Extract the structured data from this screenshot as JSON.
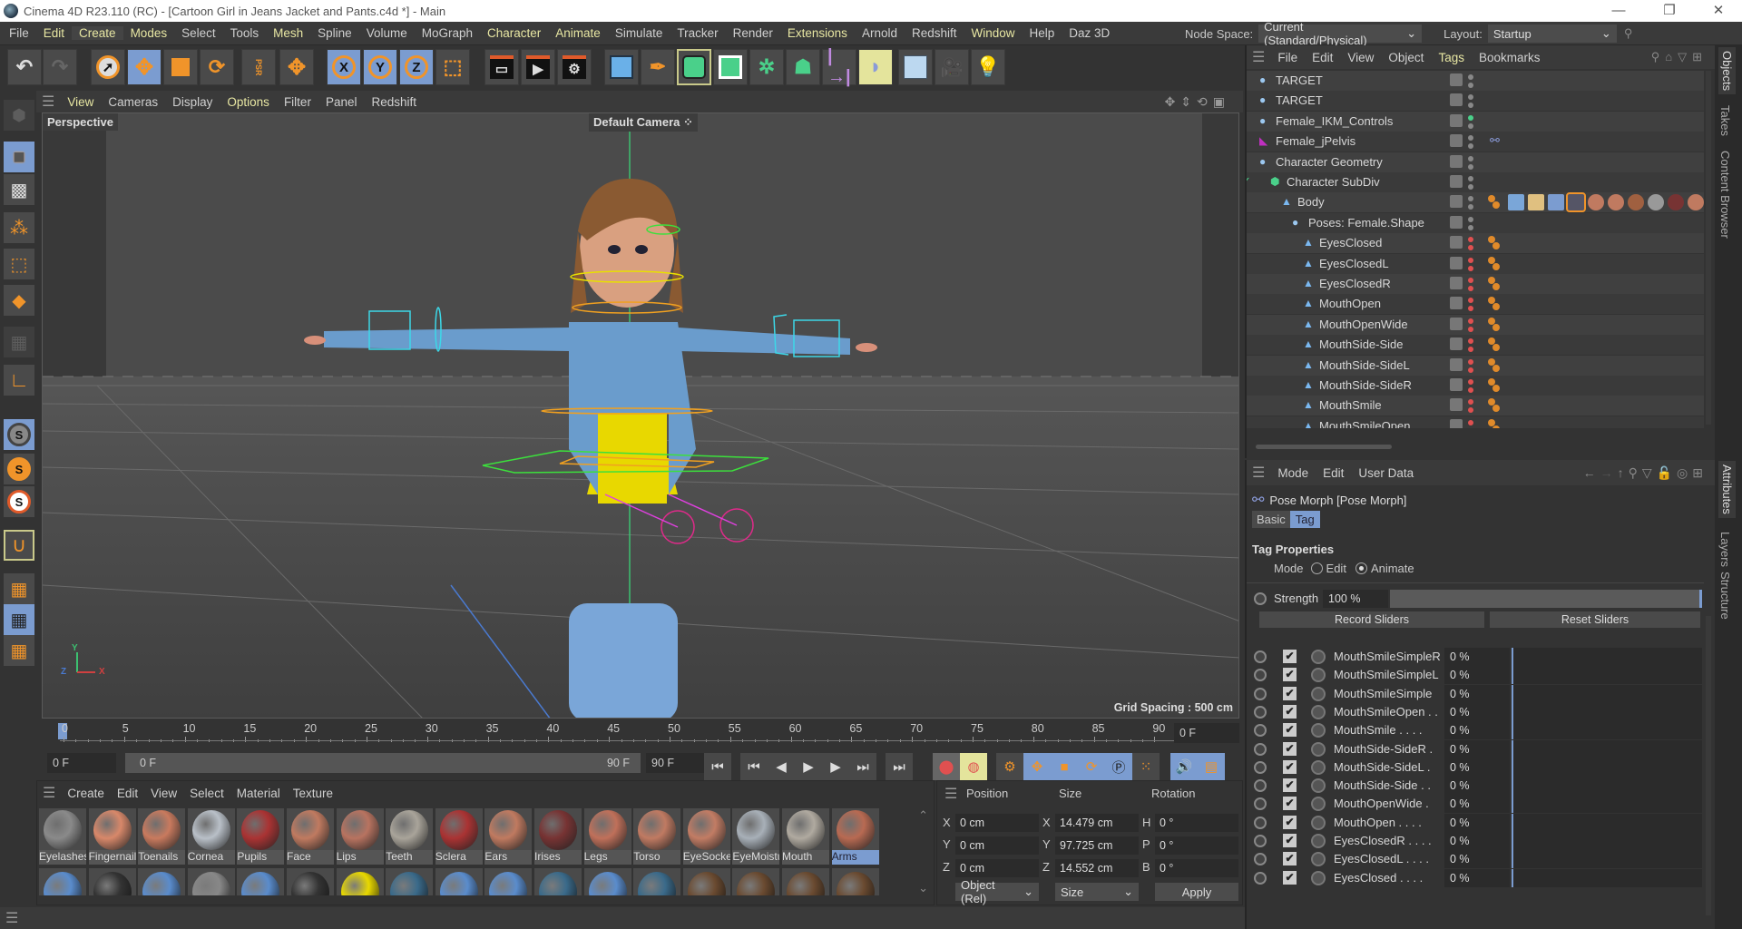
{
  "window": {
    "title": "Cinema 4D R23.110 (RC) - [Cartoon Girl in Jeans Jacket and Pants.c4d *] - Main",
    "minimize": "—",
    "restore": "❐",
    "close": "✕"
  },
  "menubar": {
    "items": [
      "File",
      "Edit",
      "Create",
      "Modes",
      "Select",
      "Tools",
      "Mesh",
      "Spline",
      "Volume",
      "MoGraph",
      "Character",
      "Animate",
      "Simulate",
      "Tracker",
      "Render",
      "Extensions",
      "Arnold",
      "Redshift",
      "Window",
      "Help",
      "Daz 3D"
    ],
    "node_space_label": "Node Space:",
    "node_space_value": "Current (Standard/Physical)",
    "layout_label": "Layout:",
    "layout_value": "Startup"
  },
  "toolbar": {
    "axis_x": "X",
    "axis_y": "Y",
    "axis_z": "Z",
    "psr": "PSR"
  },
  "viewport": {
    "menu": [
      "View",
      "Cameras",
      "Display",
      "Options",
      "Filter",
      "Panel",
      "Redshift"
    ],
    "projection": "Perspective",
    "camera": "Default Camera",
    "grid_spacing": "Grid Spacing : 500 cm",
    "axis_x": "X",
    "axis_y": "Y",
    "axis_z": "Z"
  },
  "timeline": {
    "ticks": [
      "0",
      "5",
      "10",
      "15",
      "20",
      "25",
      "30",
      "35",
      "40",
      "45",
      "50",
      "55",
      "60",
      "65",
      "70",
      "75",
      "80",
      "85",
      "90"
    ],
    "current_frame": "0 F",
    "start_frame": "0 F",
    "range_start": "0 F",
    "range_end": "90 F",
    "end_frame": "90 F"
  },
  "material_manager": {
    "menu": [
      "Create",
      "Edit",
      "View",
      "Select",
      "Material",
      "Texture"
    ],
    "materials": [
      {
        "name": "Eyelashes",
        "color": "#8a8a8a"
      },
      {
        "name": "Fingernails",
        "color": "#d8886a"
      },
      {
        "name": "Toenails",
        "color": "#c97a5e"
      },
      {
        "name": "Cornea",
        "color": "#b9c0c8"
      },
      {
        "name": "Pupils",
        "color": "#a33"
      },
      {
        "name": "Face",
        "color": "#c07a60"
      },
      {
        "name": "Lips",
        "color": "#b87360"
      },
      {
        "name": "Teeth",
        "color": "#a9a49a"
      },
      {
        "name": "Sclera",
        "color": "#a33"
      },
      {
        "name": "Ears",
        "color": "#c07a60"
      },
      {
        "name": "Irises",
        "color": "#733"
      },
      {
        "name": "Legs",
        "color": "#c0705a"
      },
      {
        "name": "Torso",
        "color": "#c07a62"
      },
      {
        "name": "EyeSocket",
        "color": "#c27c64"
      },
      {
        "name": "EyeMoisture",
        "color": "#a8b0b8"
      },
      {
        "name": "Mouth",
        "color": "#b0aaa0"
      },
      {
        "name": "Arms",
        "color": "#b86a52"
      }
    ],
    "row2_colors": [
      "#5a8ccc",
      "#333",
      "#5a8ccc",
      "#888",
      "#5a8ccc",
      "#333",
      "#e8d800",
      "#3a6a8a",
      "#5a8ccc",
      "#5a8ccc",
      "#3a6a8a",
      "#5a8ccc",
      "#3a6a8a",
      "#6a4a30",
      "#6a4a30",
      "#6a4a30",
      "#6a4a30"
    ]
  },
  "coordinates": {
    "headers": [
      "Position",
      "Size",
      "Rotation"
    ],
    "position": [
      {
        "axis": "X",
        "value": "0 cm"
      },
      {
        "axis": "Y",
        "value": "0 cm"
      },
      {
        "axis": "Z",
        "value": "0 cm"
      }
    ],
    "size": [
      {
        "axis": "X",
        "value": "14.479 cm"
      },
      {
        "axis": "Y",
        "value": "97.725 cm"
      },
      {
        "axis": "Z",
        "value": "14.552 cm"
      }
    ],
    "rotation": [
      {
        "axis": "H",
        "value": "0 °"
      },
      {
        "axis": "P",
        "value": "0 °"
      },
      {
        "axis": "B",
        "value": "0 °"
      }
    ],
    "mode_select": "Object (Rel)",
    "size_select": "Size",
    "apply": "Apply"
  },
  "object_manager": {
    "menu": [
      "File",
      "Edit",
      "View",
      "Object",
      "Tags",
      "Bookmarks"
    ],
    "objects": [
      {
        "name": "TARGET",
        "indent": 0,
        "dot": "grey"
      },
      {
        "name": "TARGET",
        "indent": 0,
        "dot": "grey"
      },
      {
        "name": "Female_IKM_Controls",
        "indent": 0,
        "dot": "green"
      },
      {
        "name": "Female_jPelvis",
        "indent": 0,
        "dot": "grey"
      },
      {
        "name": "Character Geometry",
        "indent": 0,
        "dot": "grey"
      },
      {
        "name": "Character SubDiv",
        "indent": 1,
        "dot": "grey"
      },
      {
        "name": "Body",
        "indent": 2,
        "dot": "grey"
      },
      {
        "name": "Poses: Female.Shape",
        "indent": 3,
        "dot": "grey"
      },
      {
        "name": "EyesClosed",
        "indent": 4,
        "dot": "red"
      },
      {
        "name": "EyesClosedL",
        "indent": 4,
        "dot": "red"
      },
      {
        "name": "EyesClosedR",
        "indent": 4,
        "dot": "red"
      },
      {
        "name": "MouthOpen",
        "indent": 4,
        "dot": "red"
      },
      {
        "name": "MouthOpenWide",
        "indent": 4,
        "dot": "red"
      },
      {
        "name": "MouthSide-Side",
        "indent": 4,
        "dot": "red"
      },
      {
        "name": "MouthSide-SideL",
        "indent": 4,
        "dot": "red"
      },
      {
        "name": "MouthSide-SideR",
        "indent": 4,
        "dot": "red"
      },
      {
        "name": "MouthSmile",
        "indent": 4,
        "dot": "red"
      },
      {
        "name": "MouthSmileOpen",
        "indent": 4,
        "dot": "red"
      }
    ]
  },
  "attributes": {
    "menu": [
      "Mode",
      "Edit",
      "User Data"
    ],
    "object_title": "Pose Morph [Pose Morph]",
    "tabs": [
      "Basic",
      "Tag"
    ],
    "section": "Tag Properties",
    "mode_label": "Mode",
    "mode_options": [
      "Edit",
      "Animate"
    ],
    "mode_selected": "Animate",
    "strength_label": "Strength",
    "strength_value": "100 %",
    "strength_fraction": 1.0,
    "record_sliders": "Record Sliders",
    "reset_sliders": "Reset Sliders",
    "morphs": [
      {
        "name": "MouthSmileSimpleR",
        "value": "0 %"
      },
      {
        "name": "MouthSmileSimpleL",
        "value": "0 %"
      },
      {
        "name": "MouthSmileSimple",
        "value": "0 %"
      },
      {
        "name": "MouthSmileOpen . .",
        "value": "0 %"
      },
      {
        "name": "MouthSmile . . . .",
        "value": "0 %"
      },
      {
        "name": "MouthSide-SideR .",
        "value": "0 %"
      },
      {
        "name": "MouthSide-SideL .",
        "value": "0 %"
      },
      {
        "name": "MouthSide-Side . .",
        "value": "0 %"
      },
      {
        "name": "MouthOpenWide .",
        "value": "0 %"
      },
      {
        "name": "MouthOpen . . . .",
        "value": "0 %"
      },
      {
        "name": "EyesClosedR . . . .",
        "value": "0 %"
      },
      {
        "name": "EyesClosedL . . . .",
        "value": "0 %"
      },
      {
        "name": "EyesClosed . . . .",
        "value": "0 %"
      }
    ]
  },
  "side_tabs": {
    "top": [
      "Objects",
      "Takes",
      "Content Browser"
    ],
    "bottom": [
      "Attributes",
      "Layers",
      "Structure"
    ]
  },
  "colors": {
    "accent_blue": "#7b9cd0",
    "highlight_yellow": "#e8e7a3",
    "orange": "#f0942a"
  }
}
